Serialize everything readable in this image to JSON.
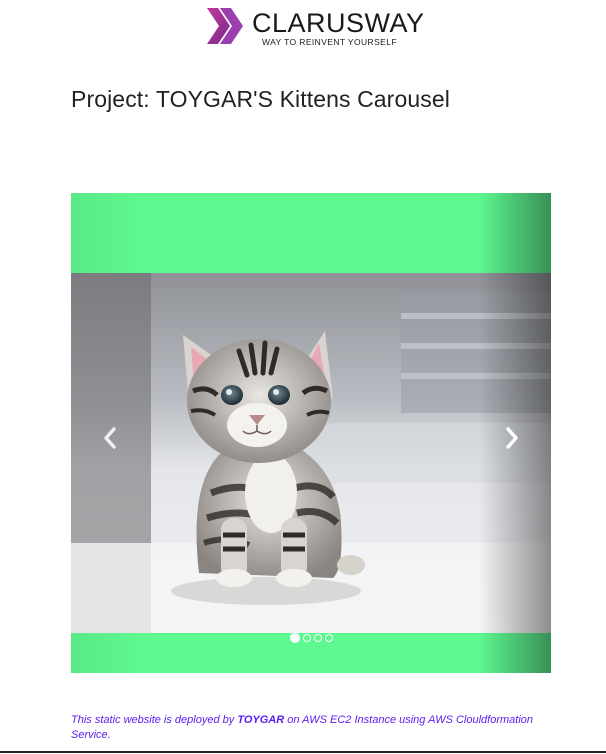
{
  "header": {
    "logo_name": "CLARUSWAY",
    "logo_tagline": "WAY TO REINVENT YOURSELF",
    "logo_icon": "double-chevron-logo-icon"
  },
  "page": {
    "title": "Project: TOYGAR'S Kittens Carousel"
  },
  "carousel": {
    "background_color": "#5ef890",
    "slide_count": 4,
    "active_slide": 1,
    "slide_image": "kitten-photo",
    "prev_icon": "chevron-left-icon",
    "next_icon": "chevron-right-icon"
  },
  "footer": {
    "text_before": "This static website is deployed by ",
    "author": "TOYGAR",
    "text_after": " on AWS EC2 Instance using AWS Clouldformation Service.",
    "color": "#5a1ff0"
  }
}
